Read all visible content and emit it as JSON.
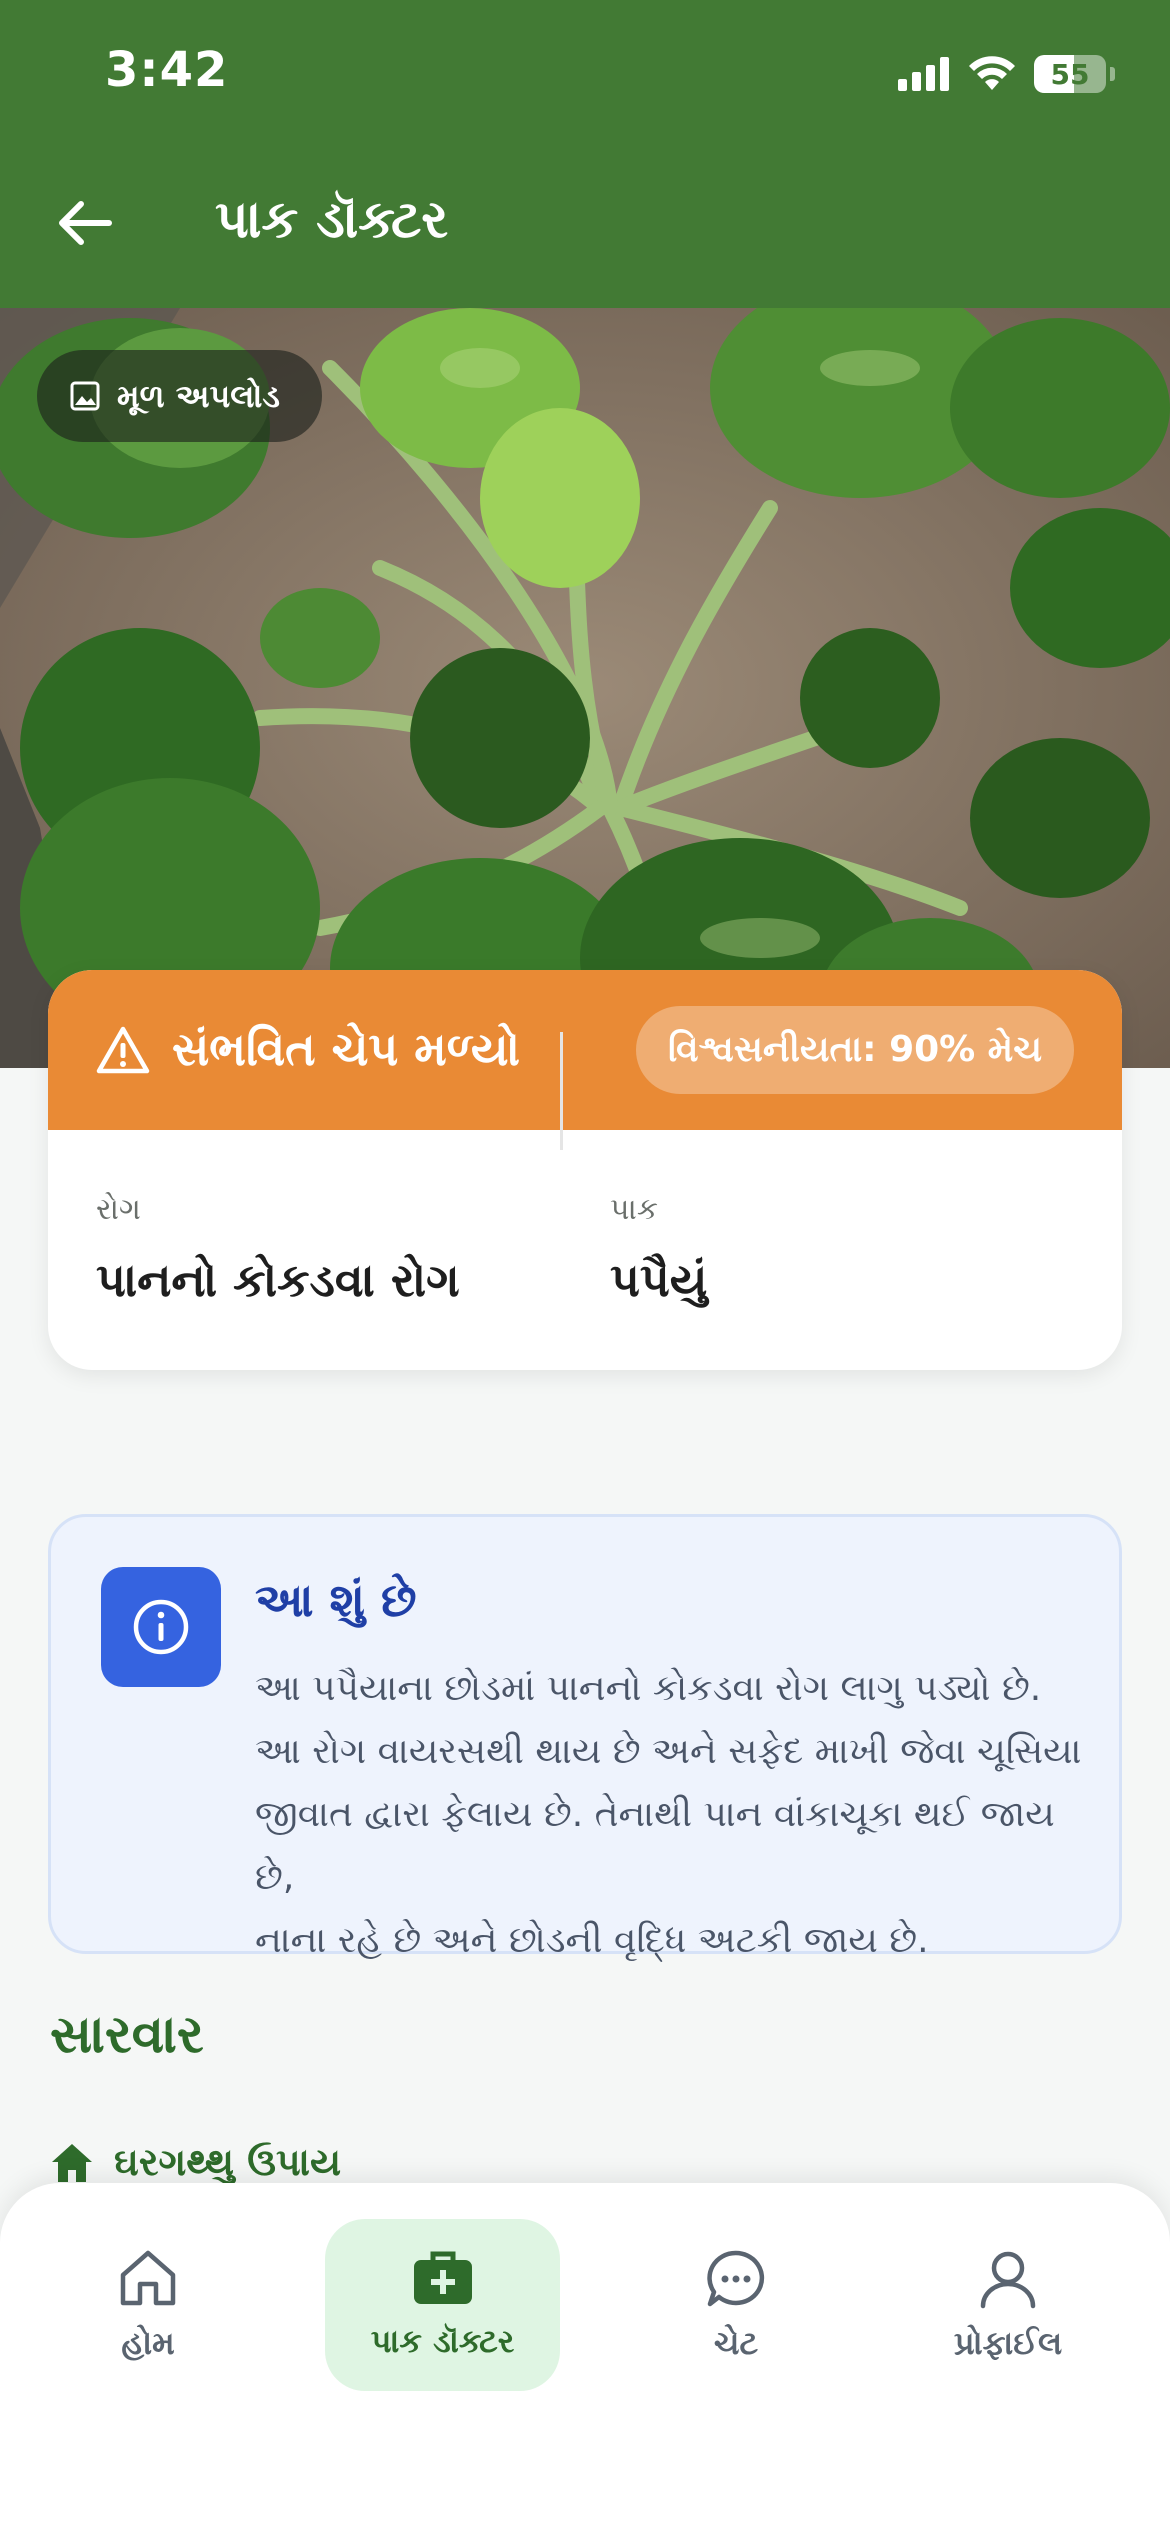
{
  "status_bar": {
    "time": "3:42",
    "battery": "55",
    "battery_level": 0.55
  },
  "header": {
    "title": "પાક ડૉક્ટર",
    "back_icon": "arrow-left-icon"
  },
  "hero": {
    "chip_label": "મૂળ અપલોડ",
    "chip_icon": "image-icon"
  },
  "result": {
    "title": "સંભવિત ચેપ મળ્યો",
    "confidence": "વિશ્વસનીયતા: 90% મેચ",
    "disease_label": "રોગ",
    "disease_value": "પાનનો કોકડવા રોગ",
    "crop_label": "પાક",
    "crop_value": "પપૈયું",
    "accent": "#e98a35"
  },
  "info": {
    "title": "આ શું છે",
    "lines": [
      "આ પપૈયાના છોડમાં પાનનો કોકડવા રોગ લાગુ પડ્યો છે.",
      "આ રોગ વાયરસથી થાય છે અને સફેદ માખી જેવા ચૂસિયા",
      "જીવાત દ્વારા ફેલાય છે. તેનાથી પાન વાંકાચૂકા થઈ જાય છે,",
      "નાના રહે છે અને છોડની વૃદ્ધિ અટકી જાય છે."
    ]
  },
  "treatment": {
    "title": "સારવાર",
    "home_remedies": "ઘરગથ્થુ ઉપાય"
  },
  "bottom_nav": {
    "items": [
      {
        "label": "હોમ",
        "icon": "home-icon"
      },
      {
        "label": "પાક ડૉક્ટર",
        "icon": "medical-kit-icon"
      },
      {
        "label": "ચેટ",
        "icon": "chat-icon"
      },
      {
        "label": "પ્રોફાઈલ",
        "icon": "user-icon"
      }
    ]
  },
  "colors": {
    "primary_green": "#427a34",
    "info_blue": "#3563e0",
    "warning_orange": "#e98a35"
  }
}
